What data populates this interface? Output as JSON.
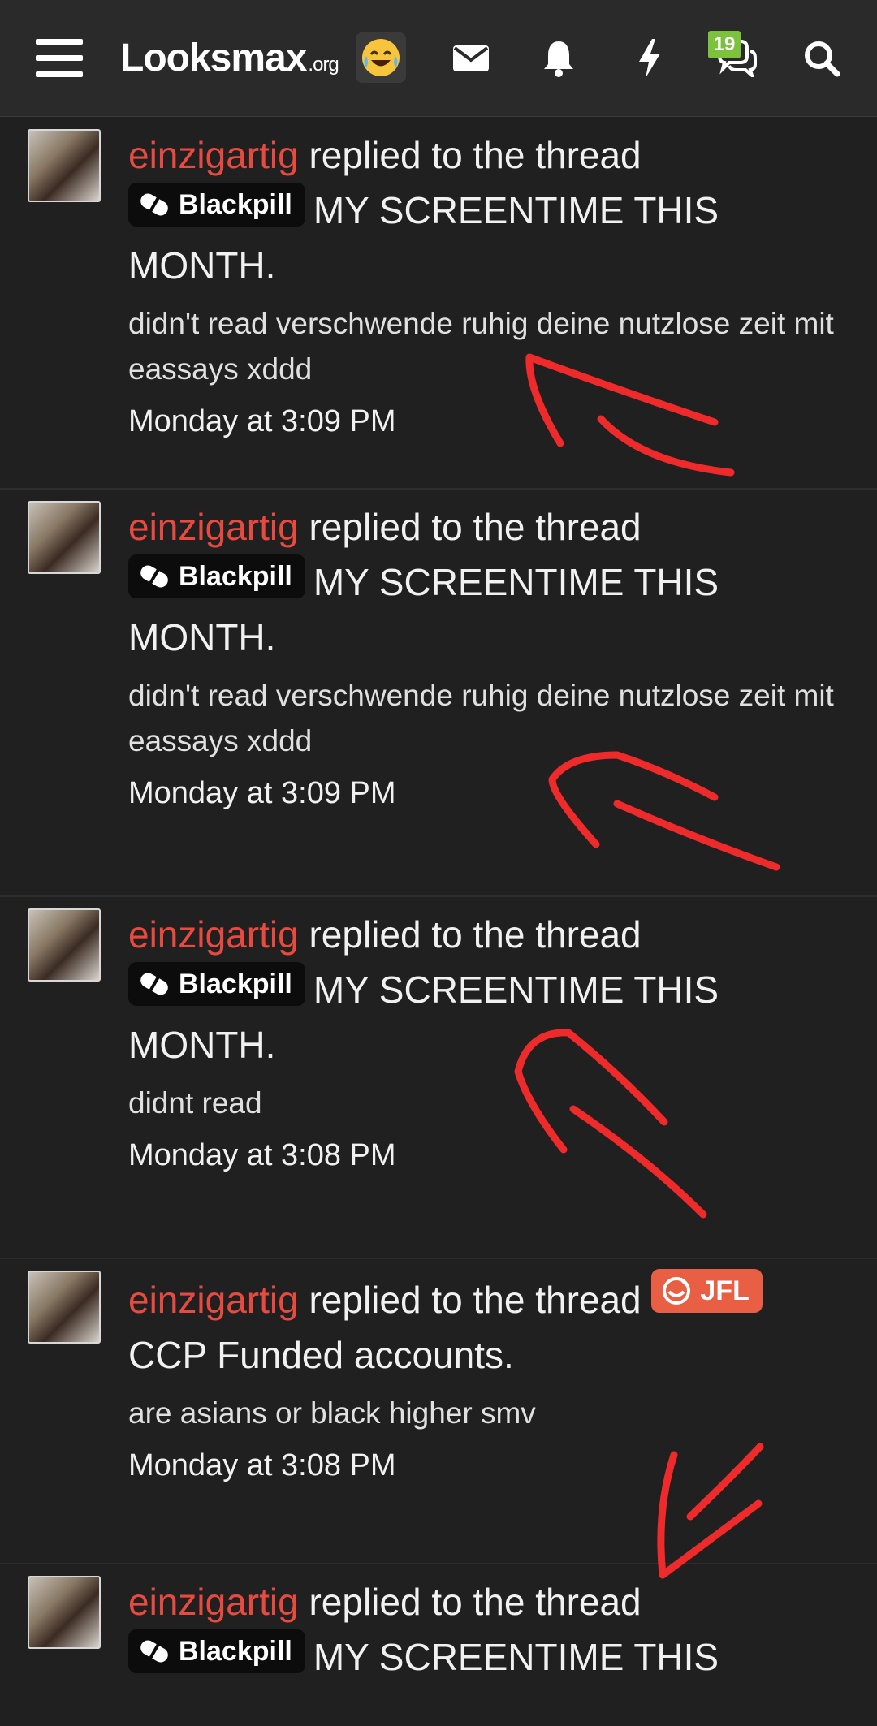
{
  "header": {
    "logo_main": "Lооksmax",
    "logo_tld": ".org",
    "emoji": "😂",
    "conversations_badge": "19"
  },
  "feed": [
    {
      "user": "einzigartig",
      "action": "replied to the thread",
      "prefix": "Blackpill",
      "thread_title": "MY SCREENTIME THIS MONTH.",
      "snippet": "didn't read verschwende ruhig deine nutzlose zeit mit eassays xddd",
      "time": "Monday at 3:09 PM"
    },
    {
      "user": "einzigartig",
      "action": "replied to the thread",
      "prefix": "Blackpill",
      "thread_title": "MY SCREENTIME THIS MONTH.",
      "snippet": "didn't read verschwende ruhig deine nutzlose zeit mit eassays xddd",
      "time": "Monday at 3:09 PM"
    },
    {
      "user": "einzigartig",
      "action": "replied to the thread",
      "prefix": "Blackpill",
      "thread_title": "MY SCREENTIME THIS MONTH.",
      "snippet": "didnt read",
      "time": "Monday at 3:08 PM"
    },
    {
      "user": "einzigartig",
      "action": "replied to the thread",
      "prefix": "JFL",
      "thread_title": "CCP Funded accounts.",
      "snippet": "are asians or black higher smv",
      "time": "Monday at 3:08 PM"
    },
    {
      "user": "einzigartig",
      "action": "replied to the thread",
      "prefix": "Blackpill",
      "thread_title": "MY SCREENTIME THIS",
      "snippet": "",
      "time": ""
    }
  ],
  "colors": {
    "background": "#202021",
    "username": "#e84a3f",
    "annotation": "#ee2a2a",
    "jfl_prefix": "#e85f44"
  }
}
